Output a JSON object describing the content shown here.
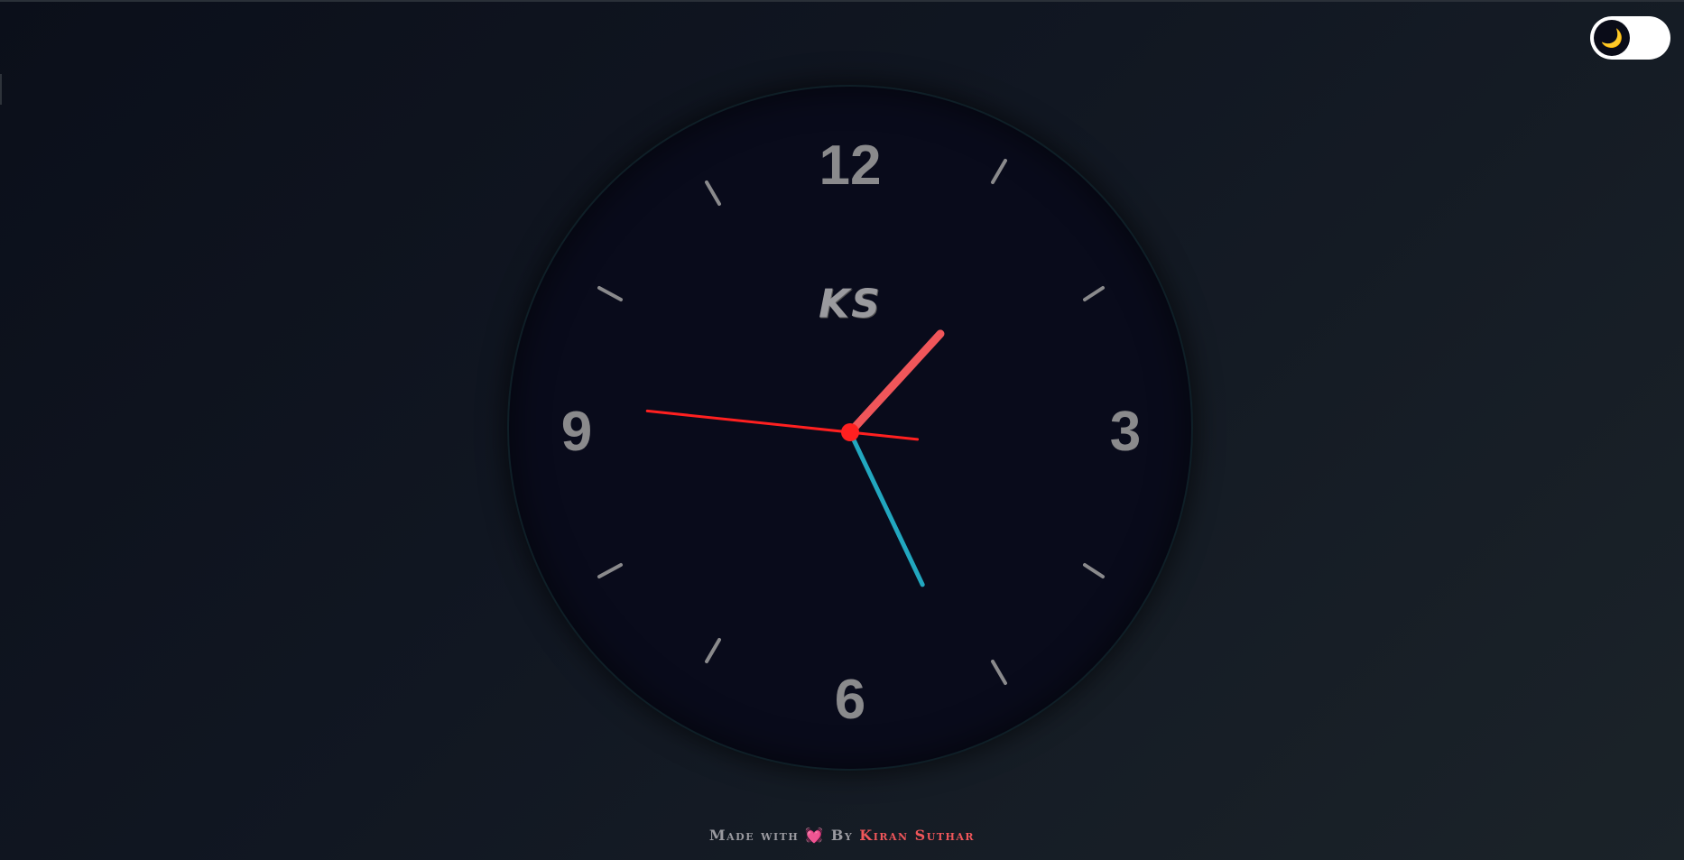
{
  "toggle": {
    "icon": "moon-icon",
    "glyph": "🌙",
    "state": "dark"
  },
  "clock": {
    "logo": "KS",
    "numerals": {
      "twelve": "12",
      "three": "3",
      "six": "6",
      "nine": "9"
    },
    "time": {
      "hour": 1,
      "minute": 25,
      "second": 46
    },
    "colors": {
      "hour_hand": "#f0565a",
      "minute_hand": "#22a7bf",
      "second_hand": "#ff2020",
      "center_dot": "#ff2020"
    }
  },
  "footer": {
    "made_with": "Made with",
    "heart": "💓",
    "by": "By",
    "author": "Kiran Suthar"
  }
}
